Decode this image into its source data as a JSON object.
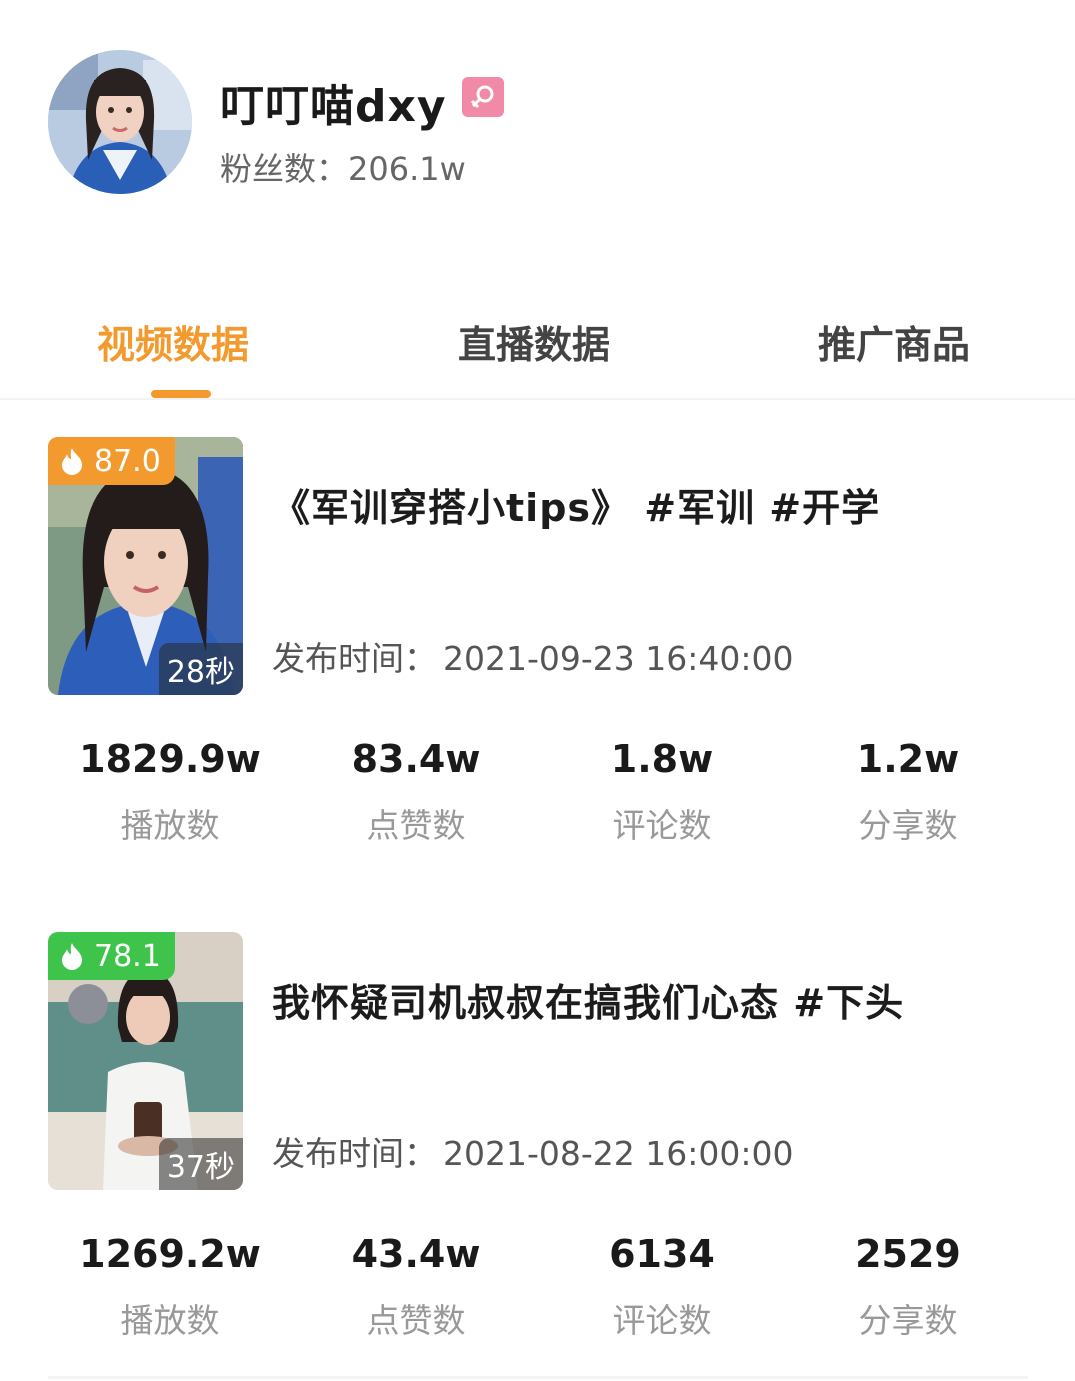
{
  "profile": {
    "name": "叮叮喵dxy",
    "gender_icon": "female-icon",
    "gender_color": "#f08aa6",
    "fans_label": "粉丝数：",
    "fans_value": "206.1w"
  },
  "tabs": [
    {
      "label": "视频数据",
      "active": true
    },
    {
      "label": "直播数据",
      "active": false
    },
    {
      "label": "推广商品",
      "active": false
    }
  ],
  "accent_color": "#f39a2e",
  "videos": [
    {
      "score": "87.0",
      "score_color": "#f39a2e",
      "duration": "28秒",
      "title": "《军训穿搭小tips》 #军训  #开学",
      "publish_label": "发布时间：",
      "publish_time": "2021-09-23 16:40:00",
      "stats": [
        {
          "value": "1829.9w",
          "label": "播放数"
        },
        {
          "value": "83.4w",
          "label": "点赞数"
        },
        {
          "value": "1.8w",
          "label": "评论数"
        },
        {
          "value": "1.2w",
          "label": "分享数"
        }
      ]
    },
    {
      "score": "78.1",
      "score_color": "#3ec44a",
      "duration": "37秒",
      "title": "我怀疑司机叔叔在搞我们心态 #下头",
      "publish_label": "发布时间：",
      "publish_time": "2021-08-22 16:00:00",
      "stats": [
        {
          "value": "1269.2w",
          "label": "播放数"
        },
        {
          "value": "43.4w",
          "label": "点赞数"
        },
        {
          "value": "6134",
          "label": "评论数"
        },
        {
          "value": "2529",
          "label": "分享数"
        }
      ]
    }
  ]
}
